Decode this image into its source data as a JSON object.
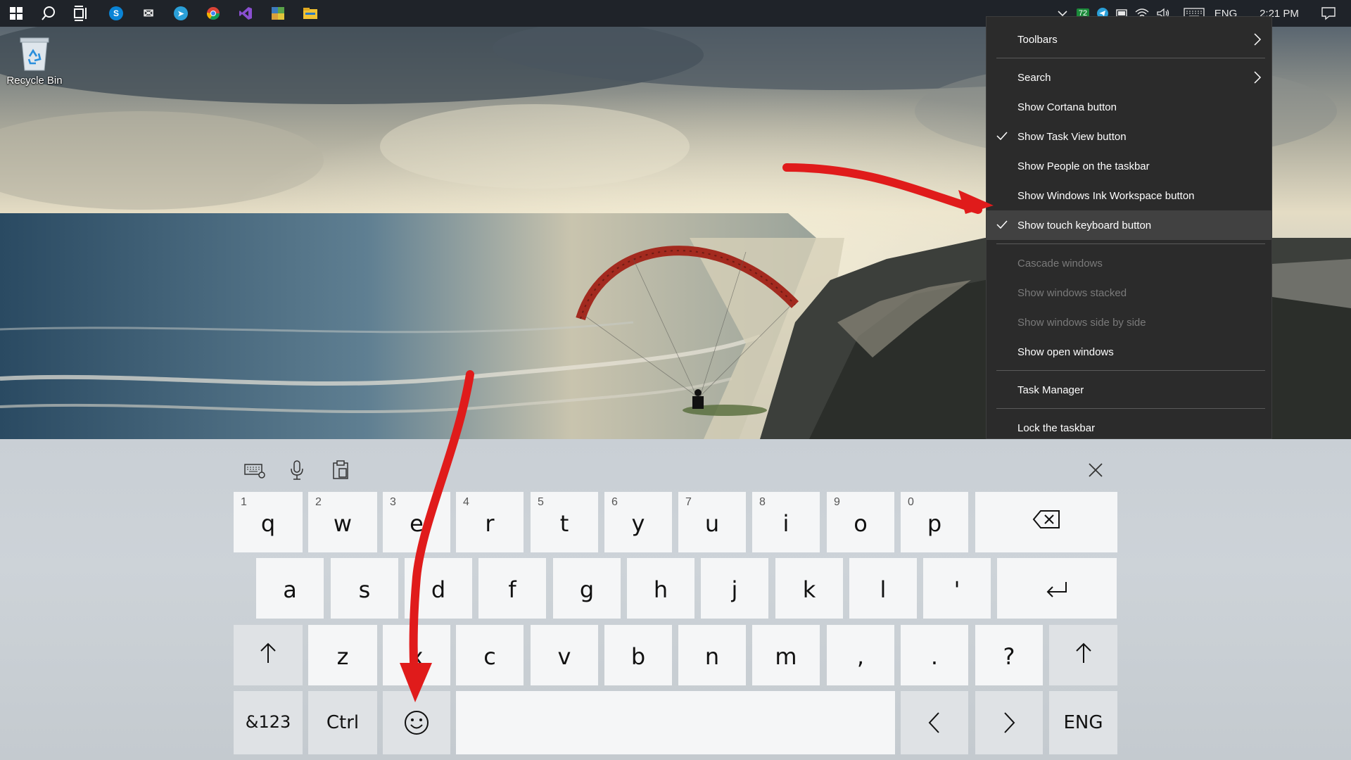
{
  "taskbar": {
    "start_icon": "windows-logo-icon",
    "search_icon": "search-icon",
    "taskview_icon": "task-view-icon",
    "apps": [
      {
        "name": "skype",
        "glyph": "S",
        "color": "#0a84d6"
      },
      {
        "name": "mail",
        "glyph": "✉",
        "color": "#e8e8e8"
      },
      {
        "name": "telegram",
        "glyph": "➤",
        "color": "#2a9fd8"
      },
      {
        "name": "chrome",
        "glyph": "●",
        "color": "#dd4b39"
      },
      {
        "name": "visual-studio",
        "glyph": "◆",
        "color": "#8a4fd1"
      },
      {
        "name": "python-app",
        "glyph": "◧",
        "color": "#e2c53a"
      },
      {
        "name": "file-explorer",
        "glyph": "▭",
        "color": "#f1c232"
      }
    ],
    "tray": {
      "badge": "72",
      "language": "ENG",
      "clock": "2:21 PM"
    }
  },
  "desktop": {
    "recycle_bin_label": "Recycle Bin"
  },
  "context_menu": {
    "items": [
      {
        "label": "Toolbars",
        "submenu": true,
        "checked": false,
        "disabled": false
      },
      {
        "label": "Search",
        "submenu": true,
        "checked": false,
        "disabled": false
      },
      {
        "label": "Show Cortana button",
        "submenu": false,
        "checked": false,
        "disabled": false
      },
      {
        "label": "Show Task View button",
        "submenu": false,
        "checked": true,
        "disabled": false
      },
      {
        "label": "Show People on the taskbar",
        "submenu": false,
        "checked": false,
        "disabled": false
      },
      {
        "label": "Show Windows Ink Workspace button",
        "submenu": false,
        "checked": false,
        "disabled": false
      },
      {
        "label": "Show touch keyboard button",
        "submenu": false,
        "checked": true,
        "disabled": false,
        "highlighted": true
      },
      {
        "label": "Cascade windows",
        "submenu": false,
        "checked": false,
        "disabled": true
      },
      {
        "label": "Show windows stacked",
        "submenu": false,
        "checked": false,
        "disabled": true
      },
      {
        "label": "Show windows side by side",
        "submenu": false,
        "checked": false,
        "disabled": true
      },
      {
        "label": "Show open windows",
        "submenu": false,
        "checked": false,
        "disabled": false
      },
      {
        "label": "Task Manager",
        "submenu": false,
        "checked": false,
        "disabled": false
      },
      {
        "label": "Lock the taskbar",
        "submenu": false,
        "checked": false,
        "disabled": false
      }
    ]
  },
  "keyboard": {
    "toolbar": {
      "settings_icon": "keyboard-settings-icon",
      "mic_icon": "microphone-icon",
      "clipboard_icon": "clipboard-icon",
      "close_icon": "close-icon"
    },
    "row1": [
      {
        "key": "q",
        "num": "1"
      },
      {
        "key": "w",
        "num": "2"
      },
      {
        "key": "e",
        "num": "3"
      },
      {
        "key": "r",
        "num": "4"
      },
      {
        "key": "t",
        "num": "5"
      },
      {
        "key": "y",
        "num": "6"
      },
      {
        "key": "u",
        "num": "7"
      },
      {
        "key": "i",
        "num": "8"
      },
      {
        "key": "o",
        "num": "9"
      },
      {
        "key": "p",
        "num": "0"
      }
    ],
    "row2": [
      "a",
      "s",
      "d",
      "f",
      "g",
      "h",
      "j",
      "k",
      "l",
      "'"
    ],
    "row3": [
      "z",
      "x",
      "c",
      "v",
      "b",
      "n",
      "m",
      ",",
      ".",
      "?"
    ],
    "symbols_label": "&123",
    "ctrl_label": "Ctrl",
    "lang_label": "ENG",
    "backspace_icon": "backspace-icon",
    "enter_icon": "enter-icon",
    "shift_icon": "shift-arrow-icon",
    "emoji_icon": "emoji-icon",
    "left_icon": "chevron-left-icon",
    "right_icon": "chevron-right-icon"
  },
  "annotation": {
    "color": "#e01b1b"
  }
}
